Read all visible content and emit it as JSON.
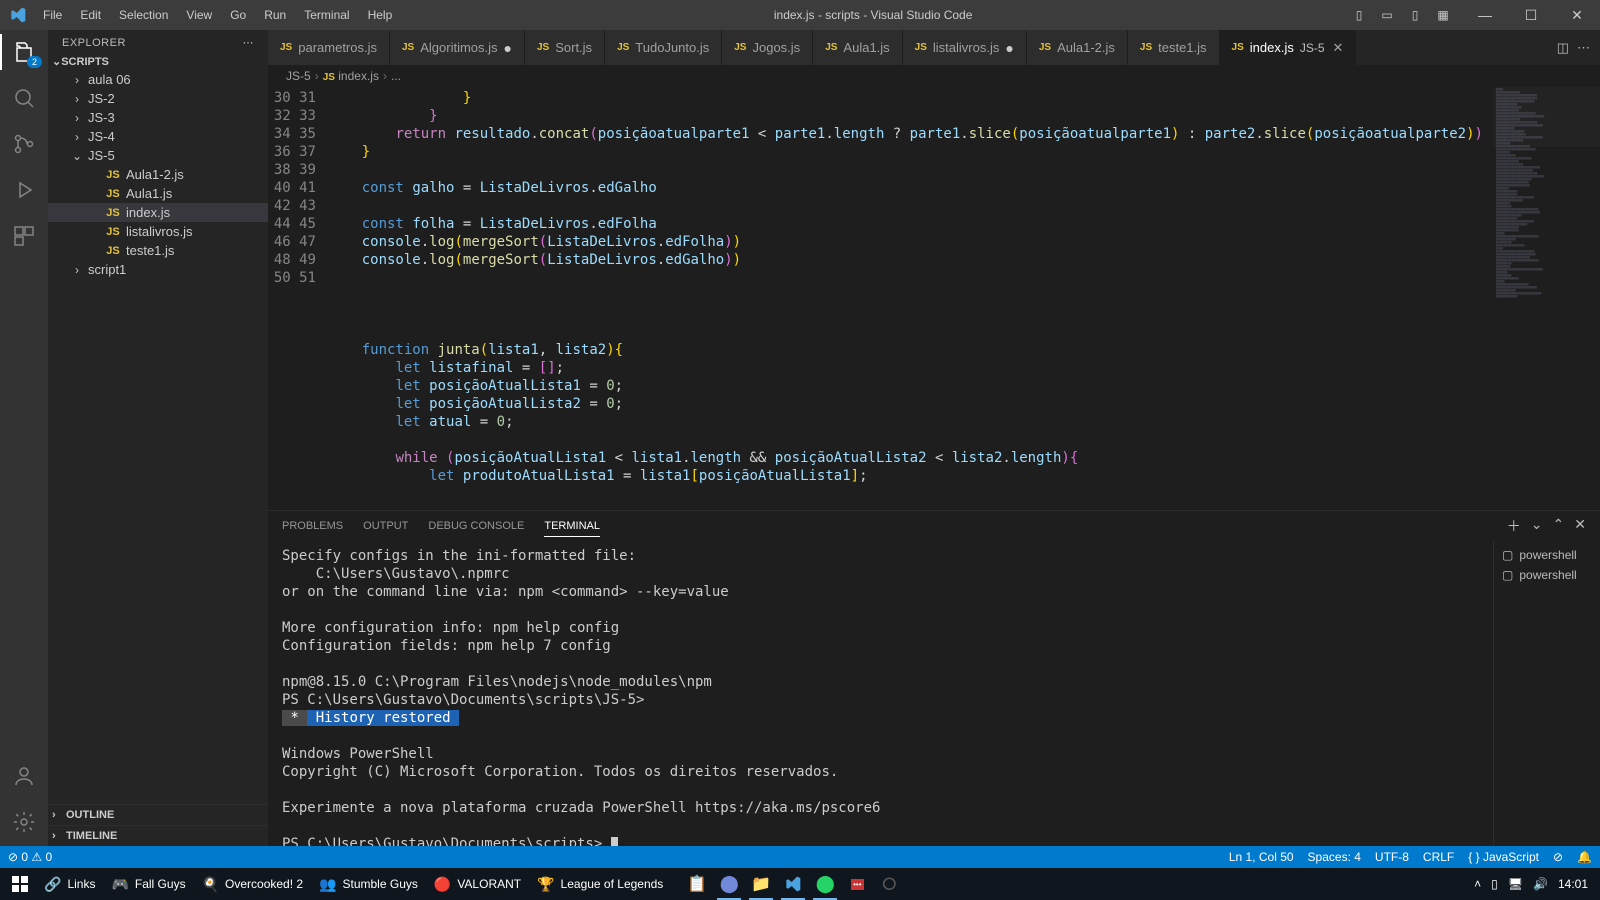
{
  "title": "index.js - scripts - Visual Studio Code",
  "menu": [
    "File",
    "Edit",
    "Selection",
    "View",
    "Go",
    "Run",
    "Terminal",
    "Help"
  ],
  "activity_badge": "2",
  "explorer": {
    "title": "EXPLORER",
    "section": "SCRIPTS",
    "items": [
      {
        "type": "folder",
        "label": "aula 06",
        "depth": 1,
        "open": false
      },
      {
        "type": "folder",
        "label": "JS-2",
        "depth": 1,
        "open": false
      },
      {
        "type": "folder",
        "label": "JS-3",
        "depth": 1,
        "open": false
      },
      {
        "type": "folder",
        "label": "JS-4",
        "depth": 1,
        "open": false
      },
      {
        "type": "folder",
        "label": "JS-5",
        "depth": 1,
        "open": true
      },
      {
        "type": "js",
        "label": "Aula1-2.js",
        "depth": 2
      },
      {
        "type": "js",
        "label": "Aula1.js",
        "depth": 2
      },
      {
        "type": "js",
        "label": "index.js",
        "depth": 2,
        "sel": true
      },
      {
        "type": "js",
        "label": "listalivros.js",
        "depth": 2
      },
      {
        "type": "js",
        "label": "teste1.js",
        "depth": 2
      },
      {
        "type": "folder",
        "label": "script1",
        "depth": 1,
        "open": false
      }
    ],
    "outline": "OUTLINE",
    "timeline": "TIMELINE"
  },
  "tabs": [
    {
      "label": "parametros.js"
    },
    {
      "label": "Algoritimos.js",
      "dirty": true
    },
    {
      "label": "Sort.js"
    },
    {
      "label": "TudoJunto.js"
    },
    {
      "label": "Jogos.js"
    },
    {
      "label": "Aula1.js"
    },
    {
      "label": "listalivros.js",
      "dirty": true
    },
    {
      "label": "Aula1-2.js"
    },
    {
      "label": "teste1.js"
    },
    {
      "label": "index.js",
      "desc": "JS-5",
      "active": true
    }
  ],
  "breadcrumbs": [
    "JS-5",
    "index.js",
    "..."
  ],
  "code_start_line": 30,
  "code_lines": [
    {
      "tokens": [
        {
          "c": "s-p",
          "t": "                "
        },
        {
          "c": "s-b",
          "t": "}"
        }
      ]
    },
    {
      "tokens": [
        {
          "c": "s-p",
          "t": "            "
        },
        {
          "c": "s-b2",
          "t": "}"
        }
      ]
    },
    {
      "tokens": [
        {
          "c": "s-p",
          "t": "        "
        },
        {
          "c": "s-kw",
          "t": "return"
        },
        {
          "c": "s-p",
          "t": " "
        },
        {
          "c": "s-v",
          "t": "resultado"
        },
        {
          "c": "s-p",
          "t": "."
        },
        {
          "c": "s-f",
          "t": "concat"
        },
        {
          "c": "s-b2",
          "t": "("
        },
        {
          "c": "s-v",
          "t": "posiçãoatualparte1"
        },
        {
          "c": "s-p",
          "t": " < "
        },
        {
          "c": "s-v",
          "t": "parte1"
        },
        {
          "c": "s-p",
          "t": "."
        },
        {
          "c": "s-v",
          "t": "length"
        },
        {
          "c": "s-p",
          "t": " ? "
        },
        {
          "c": "s-v",
          "t": "parte1"
        },
        {
          "c": "s-p",
          "t": "."
        },
        {
          "c": "s-f",
          "t": "slice"
        },
        {
          "c": "s-b",
          "t": "("
        },
        {
          "c": "s-v",
          "t": "posiçãoatualparte1"
        },
        {
          "c": "s-b",
          "t": ")"
        },
        {
          "c": "s-p",
          "t": " : "
        },
        {
          "c": "s-v",
          "t": "parte2"
        },
        {
          "c": "s-p",
          "t": "."
        },
        {
          "c": "s-f",
          "t": "slice"
        },
        {
          "c": "s-b",
          "t": "("
        },
        {
          "c": "s-v",
          "t": "posiçãoatualparte2"
        },
        {
          "c": "s-b",
          "t": ")"
        },
        {
          "c": "s-b2",
          "t": ")"
        }
      ]
    },
    {
      "tokens": [
        {
          "c": "s-p",
          "t": "    "
        },
        {
          "c": "s-b",
          "t": "}"
        }
      ]
    },
    {
      "tokens": [
        {
          "c": "s-p",
          "t": ""
        }
      ]
    },
    {
      "tokens": [
        {
          "c": "s-p",
          "t": "    "
        },
        {
          "c": "s-k",
          "t": "const"
        },
        {
          "c": "s-p",
          "t": " "
        },
        {
          "c": "s-v",
          "t": "galho"
        },
        {
          "c": "s-p",
          "t": " = "
        },
        {
          "c": "s-v",
          "t": "ListaDeLivros"
        },
        {
          "c": "s-p",
          "t": "."
        },
        {
          "c": "s-v",
          "t": "edGalho"
        }
      ]
    },
    {
      "tokens": [
        {
          "c": "s-p",
          "t": ""
        }
      ]
    },
    {
      "tokens": [
        {
          "c": "s-p",
          "t": "    "
        },
        {
          "c": "s-k",
          "t": "const"
        },
        {
          "c": "s-p",
          "t": " "
        },
        {
          "c": "s-v",
          "t": "folha"
        },
        {
          "c": "s-p",
          "t": " = "
        },
        {
          "c": "s-v",
          "t": "ListaDeLivros"
        },
        {
          "c": "s-p",
          "t": "."
        },
        {
          "c": "s-v",
          "t": "edFolha"
        }
      ]
    },
    {
      "tokens": [
        {
          "c": "s-p",
          "t": "    "
        },
        {
          "c": "s-v",
          "t": "console"
        },
        {
          "c": "s-p",
          "t": "."
        },
        {
          "c": "s-f",
          "t": "log"
        },
        {
          "c": "s-b",
          "t": "("
        },
        {
          "c": "s-f",
          "t": "mergeSort"
        },
        {
          "c": "s-b2",
          "t": "("
        },
        {
          "c": "s-v",
          "t": "ListaDeLivros"
        },
        {
          "c": "s-p",
          "t": "."
        },
        {
          "c": "s-v",
          "t": "edFolha"
        },
        {
          "c": "s-b2",
          "t": ")"
        },
        {
          "c": "s-b",
          "t": ")"
        }
      ]
    },
    {
      "tokens": [
        {
          "c": "s-p",
          "t": "    "
        },
        {
          "c": "s-v",
          "t": "console"
        },
        {
          "c": "s-p",
          "t": "."
        },
        {
          "c": "s-f",
          "t": "log"
        },
        {
          "c": "s-b",
          "t": "("
        },
        {
          "c": "s-f",
          "t": "mergeSort"
        },
        {
          "c": "s-b2",
          "t": "("
        },
        {
          "c": "s-v",
          "t": "ListaDeLivros"
        },
        {
          "c": "s-p",
          "t": "."
        },
        {
          "c": "s-v",
          "t": "edGalho"
        },
        {
          "c": "s-b2",
          "t": ")"
        },
        {
          "c": "s-b",
          "t": ")"
        }
      ]
    },
    {
      "tokens": [
        {
          "c": "s-p",
          "t": ""
        }
      ]
    },
    {
      "tokens": [
        {
          "c": "s-p",
          "t": ""
        }
      ]
    },
    {
      "tokens": [
        {
          "c": "s-p",
          "t": ""
        }
      ]
    },
    {
      "tokens": [
        {
          "c": "s-p",
          "t": ""
        }
      ]
    },
    {
      "tokens": [
        {
          "c": "s-p",
          "t": "    "
        },
        {
          "c": "s-k",
          "t": "function"
        },
        {
          "c": "s-p",
          "t": " "
        },
        {
          "c": "s-f",
          "t": "junta"
        },
        {
          "c": "s-b",
          "t": "("
        },
        {
          "c": "s-v",
          "t": "lista1"
        },
        {
          "c": "s-p",
          "t": ", "
        },
        {
          "c": "s-v",
          "t": "lista2"
        },
        {
          "c": "s-b",
          "t": ")"
        },
        {
          "c": "s-b",
          "t": "{"
        }
      ]
    },
    {
      "tokens": [
        {
          "c": "s-p",
          "t": "        "
        },
        {
          "c": "s-k",
          "t": "let"
        },
        {
          "c": "s-p",
          "t": " "
        },
        {
          "c": "s-v",
          "t": "listafinal"
        },
        {
          "c": "s-p",
          "t": " = "
        },
        {
          "c": "s-b2",
          "t": "[]"
        },
        {
          "c": "s-p",
          "t": ";"
        }
      ]
    },
    {
      "tokens": [
        {
          "c": "s-p",
          "t": "        "
        },
        {
          "c": "s-k",
          "t": "let"
        },
        {
          "c": "s-p",
          "t": " "
        },
        {
          "c": "s-v",
          "t": "posiçãoAtualLista1"
        },
        {
          "c": "s-p",
          "t": " = "
        },
        {
          "c": "s-n",
          "t": "0"
        },
        {
          "c": "s-p",
          "t": ";"
        }
      ]
    },
    {
      "tokens": [
        {
          "c": "s-p",
          "t": "        "
        },
        {
          "c": "s-k",
          "t": "let"
        },
        {
          "c": "s-p",
          "t": " "
        },
        {
          "c": "s-v",
          "t": "posiçãoAtualLista2"
        },
        {
          "c": "s-p",
          "t": " = "
        },
        {
          "c": "s-n",
          "t": "0"
        },
        {
          "c": "s-p",
          "t": ";"
        }
      ]
    },
    {
      "tokens": [
        {
          "c": "s-p",
          "t": "        "
        },
        {
          "c": "s-k",
          "t": "let"
        },
        {
          "c": "s-p",
          "t": " "
        },
        {
          "c": "s-v",
          "t": "atual"
        },
        {
          "c": "s-p",
          "t": " = "
        },
        {
          "c": "s-n",
          "t": "0"
        },
        {
          "c": "s-p",
          "t": ";"
        }
      ]
    },
    {
      "tokens": [
        {
          "c": "s-p",
          "t": ""
        }
      ]
    },
    {
      "tokens": [
        {
          "c": "s-p",
          "t": "        "
        },
        {
          "c": "s-kw",
          "t": "while"
        },
        {
          "c": "s-p",
          "t": " "
        },
        {
          "c": "s-b2",
          "t": "("
        },
        {
          "c": "s-v",
          "t": "posiçãoAtualLista1"
        },
        {
          "c": "s-p",
          "t": " < "
        },
        {
          "c": "s-v",
          "t": "lista1"
        },
        {
          "c": "s-p",
          "t": "."
        },
        {
          "c": "s-v",
          "t": "length"
        },
        {
          "c": "s-p",
          "t": " && "
        },
        {
          "c": "s-v",
          "t": "posiçãoAtualLista2"
        },
        {
          "c": "s-p",
          "t": " < "
        },
        {
          "c": "s-v",
          "t": "lista2"
        },
        {
          "c": "s-p",
          "t": "."
        },
        {
          "c": "s-v",
          "t": "length"
        },
        {
          "c": "s-b2",
          "t": ")"
        },
        {
          "c": "s-b2",
          "t": "{"
        }
      ]
    },
    {
      "tokens": [
        {
          "c": "s-p",
          "t": "            "
        },
        {
          "c": "s-k",
          "t": "let"
        },
        {
          "c": "s-p",
          "t": " "
        },
        {
          "c": "s-v",
          "t": "produtoAtualLista1"
        },
        {
          "c": "s-p",
          "t": " = "
        },
        {
          "c": "s-v",
          "t": "lista1"
        },
        {
          "c": "s-b",
          "t": "["
        },
        {
          "c": "s-v",
          "t": "posiçãoAtualLista1"
        },
        {
          "c": "s-b",
          "t": "]"
        },
        {
          "c": "s-p",
          "t": ";"
        }
      ]
    }
  ],
  "panel": {
    "tabs": [
      "PROBLEMS",
      "OUTPUT",
      "DEBUG CONSOLE",
      "TERMINAL"
    ],
    "active": "TERMINAL",
    "terminals": [
      "powershell",
      "powershell"
    ],
    "lines": [
      "Specify configs in the ini-formatted file:",
      "    C:\\Users\\Gustavo\\.npmrc",
      "or on the command line via: npm <command> --key=value",
      "",
      "More configuration info: npm help config",
      "Configuration fields: npm help 7 config",
      "",
      "npm@8.15.0 C:\\Program Files\\nodejs\\node_modules\\npm",
      "PS C:\\Users\\Gustavo\\Documents\\scripts\\JS-5>"
    ],
    "hist_prefix": " * ",
    "hist": " History restored ",
    "lines2": [
      "",
      "Windows PowerShell",
      "Copyright (C) Microsoft Corporation. Todos os direitos reservados.",
      "",
      "Experimente a nova plataforma cruzada PowerShell https://aka.ms/pscore6",
      ""
    ],
    "prompt": "PS C:\\Users\\Gustavo\\Documents\\scripts> "
  },
  "status": {
    "left": [
      "⊘ 0 ⚠ 0"
    ],
    "right": [
      "Ln 1, Col 50",
      "Spaces: 4",
      "UTF-8",
      "CRLF",
      "{ } JavaScript",
      "⊘",
      "🔔"
    ]
  },
  "taskbar": {
    "items": [
      "Links",
      "Fall Guys",
      "Overcooked! 2",
      "Stumble Guys",
      "VALORANT",
      "League of Legends"
    ],
    "clock": "14:01"
  }
}
